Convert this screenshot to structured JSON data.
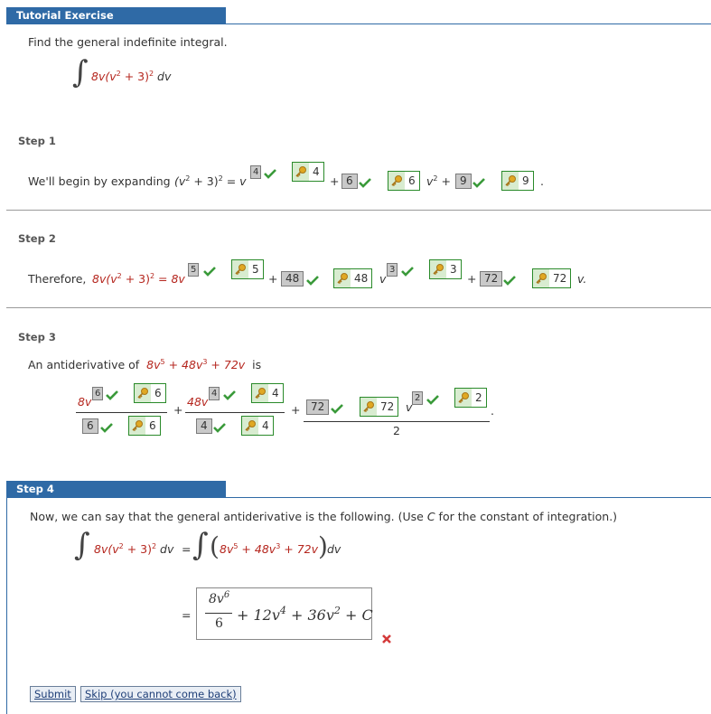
{
  "header": {
    "title": "Tutorial Exercise"
  },
  "problem": {
    "prompt": "Find the general indefinite integral.",
    "coef": "8v(v",
    "p2": "2",
    "mid": " + 3)",
    "p3": "2",
    "dv": " dv"
  },
  "step1": {
    "title": "Step 1",
    "lead": "We'll begin by expanding",
    "expr_a": "(v",
    "expr_b": "2",
    "expr_c": " + 3)",
    "expr_d": "2",
    "expr_e": " = v",
    "sbox1": "4",
    "key1": "4",
    "plus1": "+",
    "bbox1": "6",
    "key2": "6",
    "v2": "v",
    "v2sup": "2",
    "plus2": "+",
    "bbox2": "9",
    "key3": "9",
    "period": "."
  },
  "step2": {
    "title": "Step 2",
    "lead": "Therefore,",
    "e1": "8v(v",
    "e2": "2",
    "e3": " + 3)",
    "e4": "2",
    "e5": " = 8v",
    "sbox1": "5",
    "key1": "5",
    "plus1": "+",
    "bbox1": "48",
    "key2": "48",
    "v": "v",
    "sbox2": "3",
    "key3": "3",
    "plus2": "+",
    "bbox2": "72",
    "key4": "72",
    "tail": "v."
  },
  "step3": {
    "title": "Step 3",
    "lead": "An antiderivative of",
    "t1": "8v",
    "t1s": "5",
    "t2": " + 48v",
    "t2s": "3",
    "t3": " + 72v",
    "is": "is",
    "f1_num": "8v",
    "f1_sbox": "6",
    "f1_key": "6",
    "f1_den_box": "6",
    "f1_den_key": "6",
    "plus1": "+",
    "f2_num": "48v",
    "f2_sbox": "4",
    "f2_key": "4",
    "f2_den_box": "4",
    "f2_den_key": "4",
    "plus2": "+",
    "f3_box": "72",
    "f3_key": "72",
    "f3_v": "v",
    "f3_sbox": "2",
    "f3_key2": "2",
    "f3_den": "2",
    "period": "."
  },
  "step4": {
    "title": "Step 4",
    "instruction_a": "Now, we can say that the general antiderivative is the following. (Use ",
    "instruction_c": "C",
    "instruction_b": " for the constant of integration.)",
    "lhs_a": "8v(v",
    "lhs_b": "2",
    "lhs_c": " + 3)",
    "lhs_d": "2",
    "lhs_e": " dv",
    "eq": "=",
    "rhs_a": "8v",
    "rhs_b": "5",
    "rhs_c": " + 48v",
    "rhs_d": "3",
    "rhs_e": " + 72v",
    "rhs_dv": " dv",
    "ans_num": "8v",
    "ans_num_sup": "6",
    "ans_den": "6",
    "ans_rest_a": "+ 12v",
    "ans_rest_b": "4",
    "ans_rest_c": " + 36v",
    "ans_rest_d": "2",
    "ans_rest_e": " + C",
    "eq2": "="
  },
  "buttons": {
    "submit": "Submit",
    "skip": "Skip (you cannot come back)"
  },
  "colors": {
    "header": "#2f6aa6",
    "check": "#3a9a3a",
    "x": "#d43a3a",
    "red_text": "#b5261e"
  }
}
